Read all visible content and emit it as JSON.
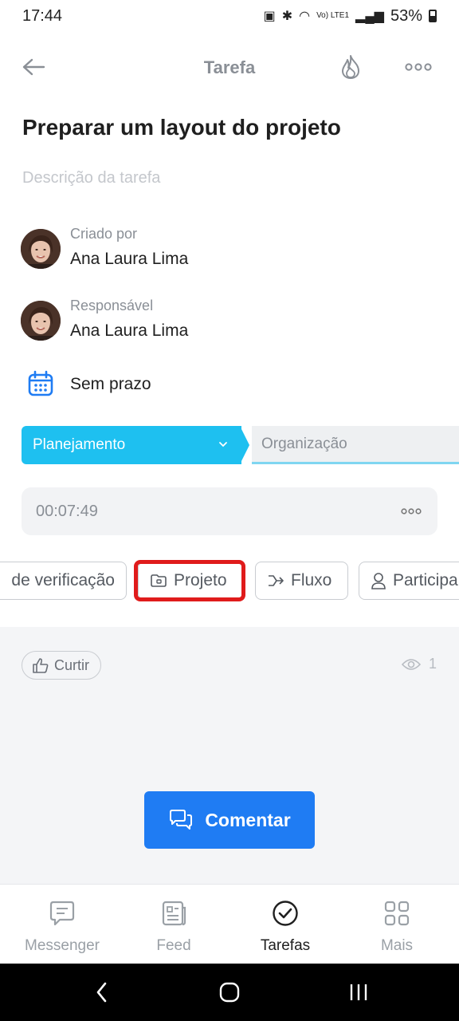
{
  "status_bar": {
    "time": "17:44",
    "battery": "53%",
    "network": "Vo) LTE1"
  },
  "header": {
    "title": "Tarefa"
  },
  "task": {
    "title": "Preparar um layout do projeto",
    "description_placeholder": "Descrição da tarefa"
  },
  "people": [
    {
      "label": "Criado por",
      "name": "Ana Laura Lima"
    },
    {
      "label": "Responsável",
      "name": "Ana Laura Lima"
    }
  ],
  "deadline": {
    "text": "Sem prazo"
  },
  "stages": {
    "current": "Planejamento",
    "next": "Organização"
  },
  "timer": {
    "value": "00:07:49"
  },
  "chips": [
    {
      "label": "de verificação",
      "icon": "checklist-icon"
    },
    {
      "label": "Projeto",
      "icon": "folder-icon"
    },
    {
      "label": "Fluxo",
      "icon": "flow-icon"
    },
    {
      "label": "Participa",
      "icon": "person-icon"
    }
  ],
  "activity": {
    "like_label": "Curtir",
    "views_count": "1",
    "comment_label": "Comentar"
  },
  "bottom_nav": [
    {
      "label": "Messenger",
      "icon": "chat-icon",
      "active": false
    },
    {
      "label": "Feed",
      "icon": "feed-icon",
      "active": false
    },
    {
      "label": "Tarefas",
      "icon": "check-circle-icon",
      "active": true
    },
    {
      "label": "Mais",
      "icon": "grid-icon",
      "active": false
    }
  ],
  "colors": {
    "accent": "#1f7cf3",
    "stage_active": "#1ec0f0",
    "highlight": "#e01b1b"
  }
}
